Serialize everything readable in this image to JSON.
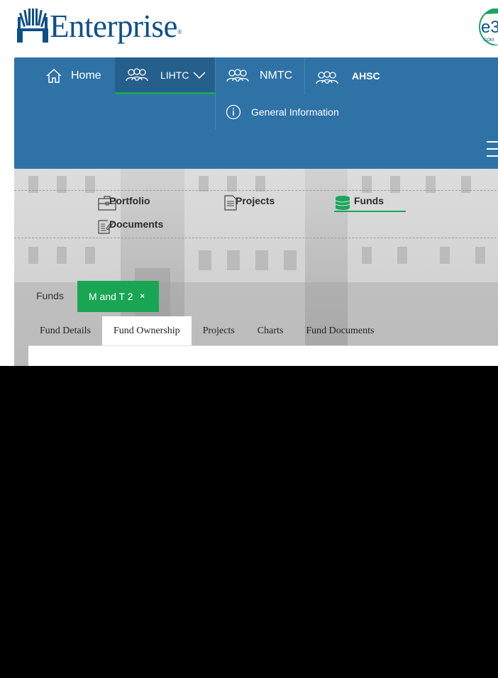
{
  "brand": {
    "name": "Enterprise",
    "registered": "®",
    "colors": {
      "brand_blue": "#0d4f8b",
      "nav_blue": "#2e72a6",
      "accent_green": "#1ea45c"
    }
  },
  "nav": {
    "home": {
      "label": "Home",
      "icon": "home-icon"
    },
    "lihtc": {
      "label": "LIHTC",
      "icon": "people-icon"
    },
    "nmtc": {
      "label": "NMTC",
      "icon": "people-icon"
    },
    "ahsc": {
      "label": "AHSC",
      "icon": "people-icon"
    },
    "sub": {
      "general_info": "General Information"
    }
  },
  "sections": {
    "portfolio": "Portfolio",
    "projects": "Projects",
    "funds": "Funds",
    "documents": "Documents"
  },
  "breadcrumb": {
    "root": "Funds",
    "current": "M and T 2",
    "close": "×"
  },
  "tabs": [
    "Fund Details",
    "Fund Ownership",
    "Projects",
    "Charts",
    "Fund Documents"
  ]
}
